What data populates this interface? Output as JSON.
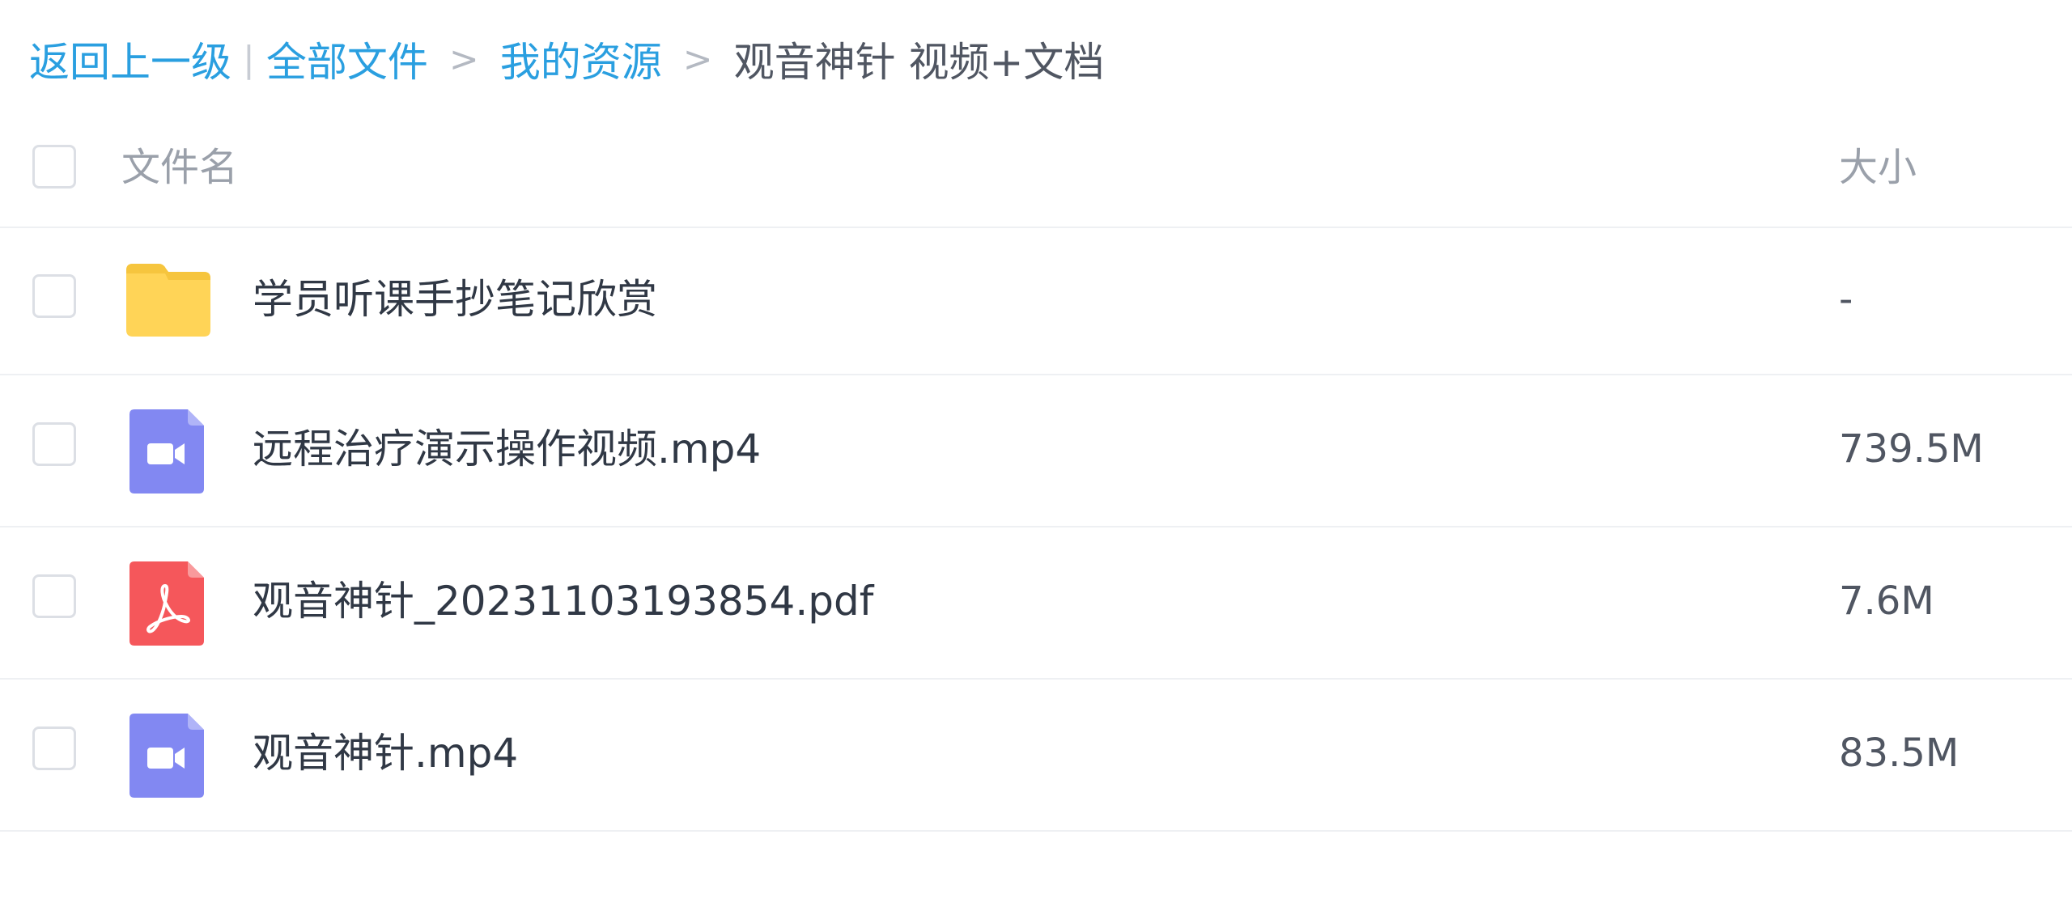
{
  "breadcrumb": {
    "back": "返回上一级",
    "pipe": "|",
    "all_files": "全部文件",
    "sep": ">",
    "my_resources": "我的资源",
    "current": "观音神针 视频+文档"
  },
  "header": {
    "name_label": "文件名",
    "size_label": "大小"
  },
  "files": [
    {
      "name": "学员听课手抄笔记欣赏",
      "size": "-",
      "type": "folder",
      "icon": "folder-icon"
    },
    {
      "name": "远程治疗演示操作视频.mp4",
      "size": "739.5M",
      "type": "video",
      "icon": "video-file-icon"
    },
    {
      "name": "观音神针_20231103193854.pdf",
      "size": "7.6M",
      "type": "pdf",
      "icon": "pdf-file-icon"
    },
    {
      "name": "观音神针.mp4",
      "size": "83.5M",
      "type": "video",
      "icon": "video-file-icon"
    }
  ],
  "colors": {
    "link": "#2a9fe0",
    "folder": "#ffd457",
    "video": "#8288f2",
    "pdf": "#f5575b"
  }
}
